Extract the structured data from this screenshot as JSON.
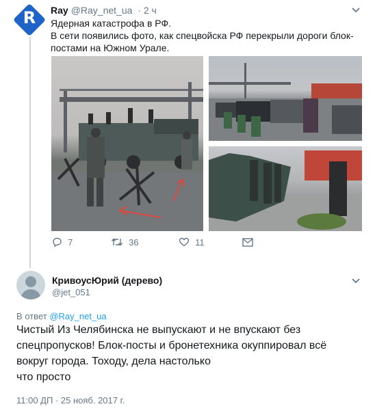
{
  "tweet": {
    "author_name": "Ray",
    "author_handle": "@Ray_net_ua",
    "time": "· 2 ч",
    "avatar_letter": "R",
    "text_lines": [
      "Ядерная катастрофа в РФ.",
      "В сети появились фото, как спецвойска РФ перекрыли дороги блок-",
      "постами на Южном Урале."
    ],
    "actions": {
      "replies": "7",
      "retweets": "36",
      "likes": "11"
    }
  },
  "reply": {
    "author_name": "КривоусЮрий (дерево)",
    "author_handle": "@jet_051",
    "reply_prefix": "В ответ",
    "reply_to": "@Ray_net_ua",
    "text_lines": [
      "Чистый                    Из Челябинска не выпускают и не впускают без",
      "спецпропусков! Блок-посты и бронетехника окуппировал всё",
      "вокруг города.                                  Тоходу, дела настолько",
      "что просто"
    ],
    "timestamp": "11:00 ДП · 25 нояб. 2017 г."
  },
  "icons": {
    "reply": "reply-icon",
    "retweet": "retweet-icon",
    "like": "heart-icon",
    "dm": "envelope-icon",
    "menu": "chevron-down-icon"
  },
  "colors": {
    "link": "#1da1f2",
    "muted": "#657786",
    "avatar": "#1e63c8"
  }
}
